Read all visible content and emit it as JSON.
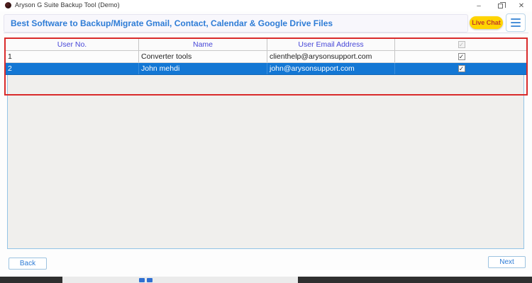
{
  "window": {
    "title": "Aryson G Suite Backup Tool (Demo)",
    "controls": {
      "minimize": "–",
      "close": "✕"
    }
  },
  "header": {
    "banner": "Best Software to Backup/Migrate Gmail, Contact, Calendar & Google Drive Files",
    "live_chat_label": "Live Chat"
  },
  "table": {
    "columns": {
      "user_no": "User No.",
      "name": "Name",
      "email": "User Email Address"
    },
    "header_checkbox": {
      "checked": true,
      "disabled": true
    },
    "rows": [
      {
        "no": "1",
        "name": "Converter tools",
        "email": "clienthelp@arysonsupport.com",
        "checked": true,
        "selected": false
      },
      {
        "no": "2",
        "name": "John mehdi",
        "email": "john@arysonsupport.com",
        "checked": true,
        "selected": true
      }
    ],
    "check_glyph": "✓"
  },
  "footer": {
    "back_label": "Back",
    "next_label": "Next"
  },
  "colors": {
    "accent_blue": "#2e7cd6",
    "column_header_blue": "#4646d8",
    "selected_row": "#1377d4",
    "annotation_red": "#d92b2b",
    "live_chat_bg": "#ffd400",
    "live_chat_text": "#c0392b",
    "panel_bg": "#f0efed",
    "panel_border": "#93c4e6"
  }
}
